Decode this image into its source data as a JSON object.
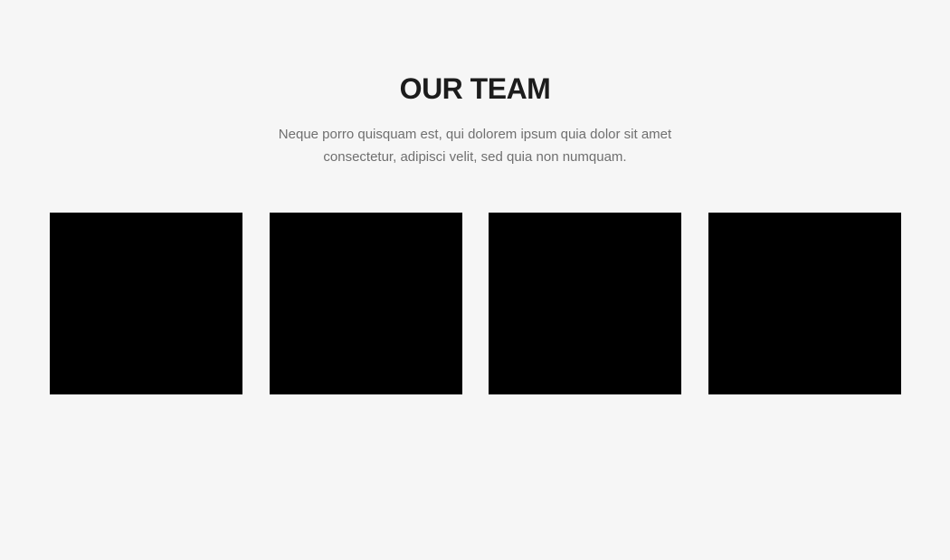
{
  "section": {
    "title": "OUR TEAM",
    "subtitle": "Neque porro quisquam est, qui dolorem ipsum quia dolor sit amet consectetur, adipisci velit, sed quia non numquam."
  },
  "colors": {
    "background": "#f6f6f6",
    "title": "#1c1c1c",
    "subtitle": "#6f6f6f",
    "member_photo": "#000000"
  },
  "team": {
    "member_count": 4
  }
}
